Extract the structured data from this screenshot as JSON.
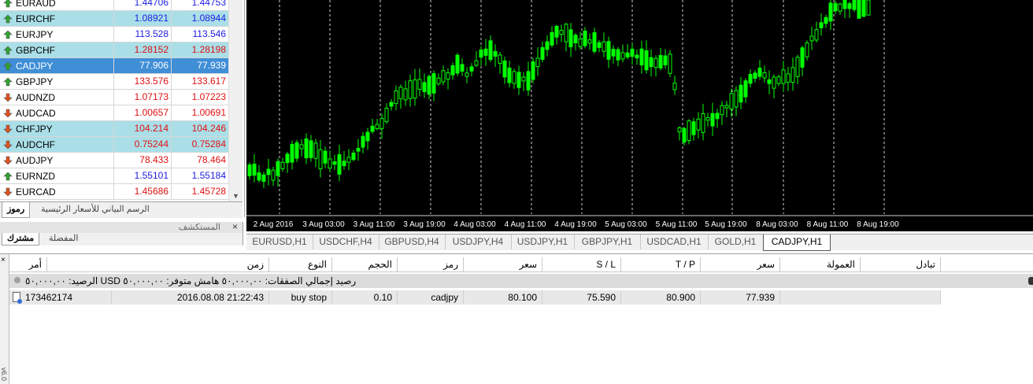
{
  "market_watch": {
    "rows": [
      {
        "symbol": "EURAUD",
        "bid": "1.44706",
        "ask": "1.44753",
        "dir": "up",
        "style": "normal",
        "color": "blue"
      },
      {
        "symbol": "EURCHF",
        "bid": "1.08921",
        "ask": "1.08944",
        "dir": "up",
        "style": "hl",
        "color": "blue"
      },
      {
        "symbol": "EURJPY",
        "bid": "113.528",
        "ask": "113.546",
        "dir": "up",
        "style": "normal",
        "color": "blue"
      },
      {
        "symbol": "GBPCHF",
        "bid": "1.28152",
        "ask": "1.28198",
        "dir": "up",
        "style": "hl",
        "color": "red"
      },
      {
        "symbol": "CADJPY",
        "bid": "77.906",
        "ask": "77.939",
        "dir": "up",
        "style": "sel",
        "color": "white"
      },
      {
        "symbol": "GBPJPY",
        "bid": "133.576",
        "ask": "133.617",
        "dir": "up",
        "style": "normal",
        "color": "red"
      },
      {
        "symbol": "AUDNZD",
        "bid": "1.07173",
        "ask": "1.07223",
        "dir": "down",
        "style": "normal",
        "color": "red"
      },
      {
        "symbol": "AUDCAD",
        "bid": "1.00657",
        "ask": "1.00691",
        "dir": "down",
        "style": "normal",
        "color": "red"
      },
      {
        "symbol": "CHFJPY",
        "bid": "104.214",
        "ask": "104.246",
        "dir": "down",
        "style": "hl",
        "color": "red"
      },
      {
        "symbol": "AUDCHF",
        "bid": "0.75244",
        "ask": "0.75284",
        "dir": "down",
        "style": "hl",
        "color": "red"
      },
      {
        "symbol": "AUDJPY",
        "bid": "78.433",
        "ask": "78.464",
        "dir": "down",
        "style": "normal",
        "color": "red"
      },
      {
        "symbol": "EURNZD",
        "bid": "1.55101",
        "ask": "1.55184",
        "dir": "up",
        "style": "normal",
        "color": "blue"
      },
      {
        "symbol": "EURCAD",
        "bid": "1.45686",
        "ask": "1.45728",
        "dir": "down",
        "style": "normal",
        "color": "red"
      }
    ],
    "tab_symbols": "رموز",
    "tab_tick_chart": "الرسم البياني للأسعار الرئيسية"
  },
  "navigator": {
    "title": "المستكشف",
    "close": "×",
    "tab_common": "مشترك",
    "tab_favorites": "المفضلة"
  },
  "chart": {
    "time_labels": [
      "2 Aug 2016",
      "3 Aug 03:00",
      "3 Aug 11:00",
      "3 Aug 19:00",
      "4 Aug 03:00",
      "4 Aug 11:00",
      "4 Aug 19:00",
      "5 Aug 03:00",
      "5 Aug 11:00",
      "5 Aug 19:00",
      "8 Aug 03:00",
      "8 Aug 11:00",
      "8 Aug 19:00"
    ],
    "tabs": [
      "EURUSD,H1",
      "USDCHF,H4",
      "GBPUSD,H4",
      "USDJPY,H4",
      "USDJPY,H1",
      "GBPJPY,H1",
      "USDCAD,H1",
      "GOLD,H1",
      "CADJPY,H1"
    ],
    "active_tab": "CADJPY,H1",
    "candle_color": "#00ff00",
    "background": "#000000"
  },
  "terminal": {
    "side_close": "×",
    "side_label": "v6.0",
    "headers": {
      "order": "أمر",
      "time": "زمن",
      "type": "النوع",
      "volume": "الحجم",
      "symbol": "رمز",
      "price": "سعر",
      "sl": "S / L",
      "tp": "T / P",
      "price2": "سعر",
      "commission": "العمولة",
      "swap": "تبادل"
    },
    "balance_line": "رصيد إجمالي الصفقات: ٥٠,٠٠٠,٠٠  هامش متوفر: ٥٠,٠٠٠,٠٠ USD  الرصيد: ٥٠,٠٠٠,٠٠",
    "order": {
      "ticket": "173462174",
      "time": "2016.08.08 21:22:43",
      "type": "buy stop",
      "volume": "0.10",
      "symbol": "cadjpy",
      "price": "80.100",
      "sl": "75.590",
      "tp": "80.900",
      "current": "77.939"
    }
  }
}
